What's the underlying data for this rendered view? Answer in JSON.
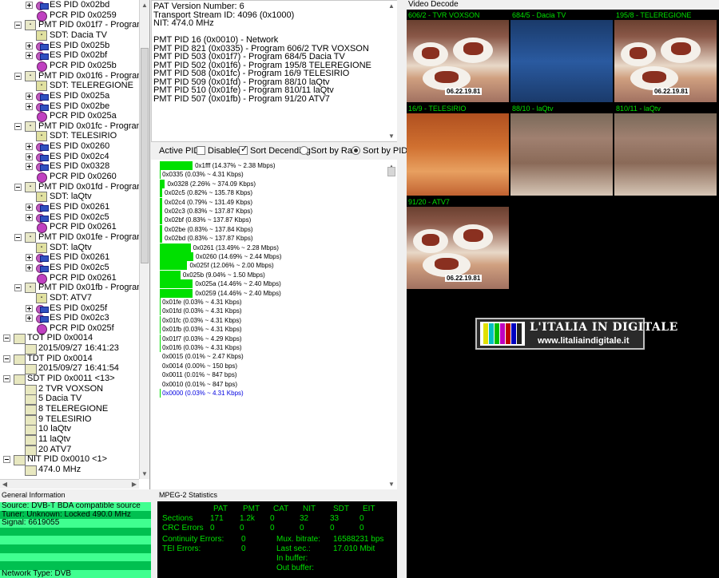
{
  "tree": {
    "rows": [
      {
        "indent": 2,
        "icon": "es",
        "exp": "plus",
        "label": "ES PID 0x02bd"
      },
      {
        "indent": 2,
        "icon": "pcr",
        "exp": "",
        "label": "PCR PID 0x0259"
      },
      {
        "indent": 1,
        "icon": "prog",
        "exp": "minus",
        "label": "PMT PID 0x01f7 - Program 5"
      },
      {
        "indent": 2,
        "icon": "sdt",
        "exp": "",
        "label": "SDT: Dacia TV"
      },
      {
        "indent": 2,
        "icon": "es",
        "exp": "plus",
        "label": "ES PID 0x025b"
      },
      {
        "indent": 2,
        "icon": "es",
        "exp": "plus",
        "label": "ES PID 0x02bf"
      },
      {
        "indent": 2,
        "icon": "pcr",
        "exp": "",
        "label": "PCR PID 0x025b"
      },
      {
        "indent": 1,
        "icon": "prog",
        "exp": "minus",
        "label": "PMT PID 0x01f6 - Program 8"
      },
      {
        "indent": 2,
        "icon": "sdt",
        "exp": "",
        "label": "SDT: TELEREGIONE"
      },
      {
        "indent": 2,
        "icon": "es",
        "exp": "plus",
        "label": "ES PID 0x025a"
      },
      {
        "indent": 2,
        "icon": "es",
        "exp": "plus",
        "label": "ES PID 0x02be"
      },
      {
        "indent": 2,
        "icon": "pcr",
        "exp": "",
        "label": "PCR PID 0x025a"
      },
      {
        "indent": 1,
        "icon": "prog",
        "exp": "minus",
        "label": "PMT PID 0x01fc - Program 9"
      },
      {
        "indent": 2,
        "icon": "sdt",
        "exp": "",
        "label": "SDT: TELESIRIO"
      },
      {
        "indent": 2,
        "icon": "es",
        "exp": "plus",
        "label": "ES PID 0x0260"
      },
      {
        "indent": 2,
        "icon": "es",
        "exp": "plus",
        "label": "ES PID 0x02c4"
      },
      {
        "indent": 2,
        "icon": "es",
        "exp": "plus",
        "label": "ES PID 0x0328"
      },
      {
        "indent": 2,
        "icon": "pcr",
        "exp": "",
        "label": "PCR PID 0x0260"
      },
      {
        "indent": 1,
        "icon": "prog",
        "exp": "minus",
        "label": "PMT PID 0x01fd - Program 10"
      },
      {
        "indent": 2,
        "icon": "sdt",
        "exp": "",
        "label": "SDT: laQtv"
      },
      {
        "indent": 2,
        "icon": "es",
        "exp": "plus",
        "label": "ES PID 0x0261"
      },
      {
        "indent": 2,
        "icon": "es",
        "exp": "plus",
        "label": "ES PID 0x02c5"
      },
      {
        "indent": 2,
        "icon": "pcr",
        "exp": "",
        "label": "PCR PID 0x0261"
      },
      {
        "indent": 1,
        "icon": "prog",
        "exp": "minus",
        "label": "PMT PID 0x01fe - Program 11"
      },
      {
        "indent": 2,
        "icon": "sdt",
        "exp": "",
        "label": "SDT: laQtv"
      },
      {
        "indent": 2,
        "icon": "es",
        "exp": "plus",
        "label": "ES PID 0x0261"
      },
      {
        "indent": 2,
        "icon": "es",
        "exp": "plus",
        "label": "ES PID 0x02c5"
      },
      {
        "indent": 2,
        "icon": "pcr",
        "exp": "",
        "label": "PCR PID 0x0261"
      },
      {
        "indent": 1,
        "icon": "prog",
        "exp": "minus",
        "label": "PMT PID 0x01fb - Program 20"
      },
      {
        "indent": 2,
        "icon": "sdt",
        "exp": "",
        "label": "SDT: ATV7"
      },
      {
        "indent": 2,
        "icon": "es",
        "exp": "plus",
        "label": "ES PID 0x025f"
      },
      {
        "indent": 2,
        "icon": "es",
        "exp": "plus",
        "label": "ES PID 0x02c3"
      },
      {
        "indent": 2,
        "icon": "pcr",
        "exp": "",
        "label": "PCR PID 0x025f"
      },
      {
        "indent": 0,
        "icon": "t",
        "exp": "minus",
        "label": "TOT PID 0x0014"
      },
      {
        "indent": 1,
        "icon": "t",
        "exp": "",
        "label": "2015/09/27 16:41:23"
      },
      {
        "indent": 0,
        "icon": "t",
        "exp": "minus",
        "label": "TDT PID 0x0014"
      },
      {
        "indent": 1,
        "icon": "t",
        "exp": "",
        "label": "2015/09/27 16:41:54"
      },
      {
        "indent": 0,
        "icon": "t",
        "exp": "minus",
        "label": "SDT PID 0x0011 <13>"
      },
      {
        "indent": 1,
        "icon": "t",
        "exp": "",
        "label": "2 TVR VOXSON"
      },
      {
        "indent": 1,
        "icon": "t",
        "exp": "",
        "label": "5 Dacia TV"
      },
      {
        "indent": 1,
        "icon": "t",
        "exp": "",
        "label": "8 TELEREGIONE"
      },
      {
        "indent": 1,
        "icon": "t",
        "exp": "",
        "label": "9 TELESIRIO"
      },
      {
        "indent": 1,
        "icon": "t",
        "exp": "",
        "label": "10 laQtv"
      },
      {
        "indent": 1,
        "icon": "t",
        "exp": "",
        "label": "11 laQtv"
      },
      {
        "indent": 1,
        "icon": "t",
        "exp": "",
        "label": "20 ATV7"
      },
      {
        "indent": 0,
        "icon": "t",
        "exp": "minus",
        "label": "NIT PID 0x0010 <1>"
      },
      {
        "indent": 1,
        "icon": "t",
        "exp": "",
        "label": "474.0 MHz"
      }
    ]
  },
  "info": {
    "lines": [
      "PAT Version Number: 6",
      "Transport Stream ID: 4096 (0x1000)",
      "NIT: 474.0 MHz",
      "",
      "PMT PID 16 (0x0010) - Network",
      "PMT PID 821 (0x0335) - Program 606/2 TVR VOXSON",
      "PMT PID 503 (0x01f7) - Program 684/5 Dacia TV",
      "PMT PID 502 (0x01f6) - Program 195/8 TELEREGIONE",
      "PMT PID 508 (0x01fc) - Program 16/9 TELESIRIO",
      "PMT PID 509 (0x01fd) - Program 88/10 laQtv",
      "PMT PID 510 (0x01fe) - Program 810/11 laQtv",
      "PMT PID 507 (0x01fb) - Program 91/20 ATV7"
    ]
  },
  "pids": {
    "title": "Active PIDs",
    "disabled_label": "Disabled",
    "sort_desc_label": "Sort Decending",
    "sort_rate_label": "Sort by Rate",
    "sort_pid_label": "Sort by PID",
    "rows": [
      {
        "pct": 14.37,
        "text": "0x1fff (14.37% ~ 2.38 Mbps)",
        "blue": false
      },
      {
        "pct": 0.03,
        "text": "0x0335 (0.03% ~ 4.31 Kbps)",
        "blue": false
      },
      {
        "pct": 2.26,
        "text": "0x0328 (2.26% ~ 374.09 Kbps)",
        "blue": false
      },
      {
        "pct": 0.82,
        "text": "0x02c5 (0.82% ~ 135.78 Kbps)",
        "blue": false
      },
      {
        "pct": 0.79,
        "text": "0x02c4 (0.79% ~ 131.49 Kbps)",
        "blue": false
      },
      {
        "pct": 0.83,
        "text": "0x02c3 (0.83% ~ 137.87 Kbps)",
        "blue": false
      },
      {
        "pct": 0.83,
        "text": "0x02bf (0.83% ~ 137.87 Kbps)",
        "blue": false
      },
      {
        "pct": 0.83,
        "text": "0x02be (0.83% ~ 137.84 Kbps)",
        "blue": false
      },
      {
        "pct": 0.83,
        "text": "0x02bd (0.83% ~ 137.87 Kbps)",
        "blue": false
      },
      {
        "pct": 13.49,
        "text": "0x0261 (13.49% ~ 2.28 Mbps)",
        "blue": false
      },
      {
        "pct": 14.69,
        "text": "0x0260 (14.69% ~ 2.44 Mbps)",
        "blue": false
      },
      {
        "pct": 12.06,
        "text": "0x025f (12.06% ~ 2.00 Mbps)",
        "blue": false
      },
      {
        "pct": 9.04,
        "text": "0x025b (9.04% ~ 1.50 Mbps)",
        "blue": false
      },
      {
        "pct": 14.46,
        "text": "0x025a (14.46% ~ 2.40 Mbps)",
        "blue": false
      },
      {
        "pct": 14.46,
        "text": "0x0259 (14.46% ~ 2.40 Mbps)",
        "blue": false
      },
      {
        "pct": 0.03,
        "text": "0x01fe (0.03% ~ 4.31 Kbps)",
        "blue": false
      },
      {
        "pct": 0.03,
        "text": "0x01fd (0.03% ~ 4.31 Kbps)",
        "blue": false
      },
      {
        "pct": 0.03,
        "text": "0x01fc (0.03% ~ 4.31 Kbps)",
        "blue": false
      },
      {
        "pct": 0.03,
        "text": "0x01fb (0.03% ~ 4.31 Kbps)",
        "blue": false
      },
      {
        "pct": 0.03,
        "text": "0x01f7 (0.03% ~ 4.29 Kbps)",
        "blue": false
      },
      {
        "pct": 0.03,
        "text": "0x01f6 (0.03% ~ 4.31 Kbps)",
        "blue": false
      },
      {
        "pct": 0.01,
        "text": "0x0015 (0.01% ~ 2.47 Kbps)",
        "blue": false
      },
      {
        "pct": 0.0,
        "text": "0x0014 (0.00% ~ 150 bps)",
        "blue": false
      },
      {
        "pct": 0.01,
        "text": "0x0011 (0.01% ~ 847 bps)",
        "blue": false
      },
      {
        "pct": 0.01,
        "text": "0x0010 (0.01% ~ 847 bps)",
        "blue": false
      },
      {
        "pct": 0.03,
        "text": "0x0000 (0.03% ~ 4.31 Kbps)",
        "blue": true
      }
    ]
  },
  "video": {
    "title": "Video Decode",
    "thumbs": [
      {
        "label": "606/2 - TVR VOXSON",
        "kind": "food",
        "date": "06.22.19.81"
      },
      {
        "label": "684/5 - Dacia TV",
        "kind": "news",
        "date": ""
      },
      {
        "label": "195/8 - TELEREGIONE",
        "kind": "food",
        "date": "06.22.19.81"
      },
      {
        "label": "16/9 - TELESIRIO",
        "kind": "promo",
        "date": ""
      },
      {
        "label": "88/10 - laQtv",
        "kind": "crowd",
        "date": ""
      },
      {
        "label": "810/11 - laQtv",
        "kind": "crowd",
        "date": ""
      },
      {
        "label": "91/20 - ATV7",
        "kind": "food",
        "date": "06.22.19.81"
      }
    ],
    "logo_title": "L'ITALIA IN DIGITALE",
    "logo_url": "www.litaliaindigitale.it"
  },
  "general": {
    "title": "General Information",
    "rows": [
      {
        "text": "Source: DVB-T BDA compatible source",
        "shade": "light"
      },
      {
        "text": "Tuner: Unknown: Locked 490.0 MHz",
        "shade": "dark"
      },
      {
        "text": "Signal: 6619055",
        "shade": "light"
      },
      {
        "text": "",
        "shade": "dark"
      },
      {
        "text": "",
        "shade": "light"
      },
      {
        "text": "",
        "shade": "dark"
      },
      {
        "text": "",
        "shade": "light"
      },
      {
        "text": "",
        "shade": "dark"
      },
      {
        "text": "Network Type: DVB",
        "shade": "light"
      }
    ]
  },
  "stats": {
    "title": "MPEG-2 Statistics",
    "headers": [
      "PAT",
      "PMT",
      "CAT",
      "NIT",
      "SDT",
      "EIT"
    ],
    "sections_label": "Sections",
    "sections": [
      "171",
      "1.2k",
      "0",
      "32",
      "33",
      "0"
    ],
    "crc_label": "CRC Errors",
    "crc": [
      "0",
      "0",
      "0",
      "0",
      "0",
      "0"
    ],
    "cont_label": "Continuity Errors:",
    "cont_value": "0",
    "tei_label": "TEI Errors:",
    "tei_value": "0",
    "mux_label": "Mux. bitrate:",
    "mux_value": "16588231 bps",
    "last_label": "Last sec.:",
    "last_value": "17.010 Mbit",
    "inbuf_label": "In buffer:",
    "outbuf_label": "Out buffer:"
  }
}
